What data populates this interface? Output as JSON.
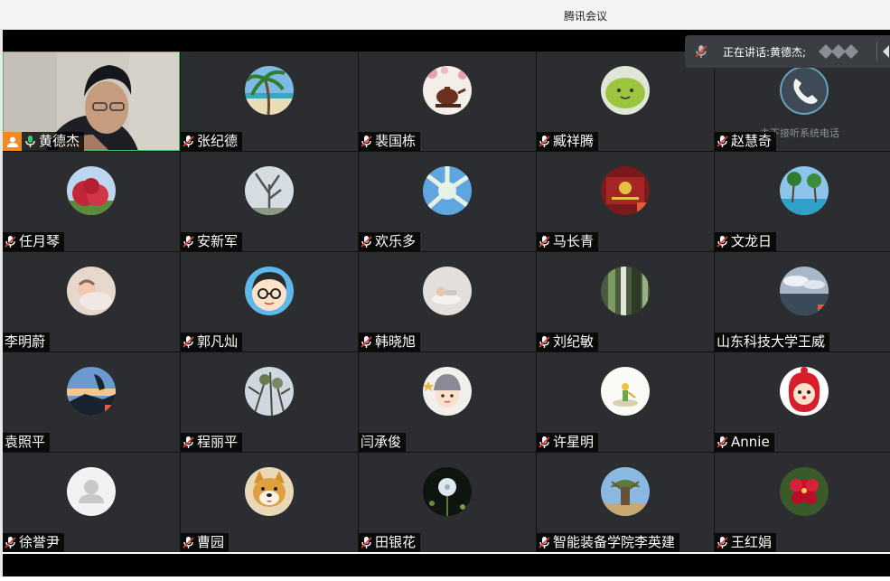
{
  "window": {
    "title": "腾讯会议"
  },
  "speaking": {
    "prefix": "正在讲话: ",
    "name": "黄德杰;"
  },
  "phone_note": "未下接听系统电话",
  "participants": [
    {
      "name": "黄德杰",
      "avatar": "video-feed"
    },
    {
      "name": "张纪德",
      "avatar": "palm-beach"
    },
    {
      "name": "裴国栋",
      "avatar": "teapot-blossom"
    },
    {
      "name": "臧祥腾",
      "avatar": "green-smiley"
    },
    {
      "name": "赵慧奇",
      "avatar": "phone-handset"
    },
    {
      "name": "任月琴",
      "avatar": "red-shrub"
    },
    {
      "name": "安新军",
      "avatar": "bare-tree"
    },
    {
      "name": "欢乐多",
      "avatar": "palm-sky"
    },
    {
      "name": "马长青",
      "avatar": "emblem-certificate"
    },
    {
      "name": "文龙日",
      "avatar": "resort-pool"
    },
    {
      "name": "李明蔚",
      "avatar": "sleeping-baby"
    },
    {
      "name": "郭凡灿",
      "avatar": "cartoon-glasses-boy"
    },
    {
      "name": "韩晓旭",
      "avatar": "baby-on-bed"
    },
    {
      "name": "刘纪敏",
      "avatar": "blurry-plants"
    },
    {
      "name": "山东科技大学王威",
      "avatar": "cloudy-sea"
    },
    {
      "name": "袁照平",
      "avatar": "sunset-silhouette"
    },
    {
      "name": "程丽平",
      "avatar": "tree-branches"
    },
    {
      "name": "闫承俊",
      "avatar": "cartoon-girl-hat"
    },
    {
      "name": "许星明",
      "avatar": "little-prince"
    },
    {
      "name": "Annie",
      "avatar": "red-doll"
    },
    {
      "name": "徐誉尹",
      "avatar": "default-person"
    },
    {
      "name": "曹园",
      "avatar": "shiba-dog"
    },
    {
      "name": "田银花",
      "avatar": "dandelion"
    },
    {
      "name": "智能装备学院李英建",
      "avatar": "baobab-tree"
    },
    {
      "name": "王红娟",
      "avatar": "red-flower"
    }
  ]
}
